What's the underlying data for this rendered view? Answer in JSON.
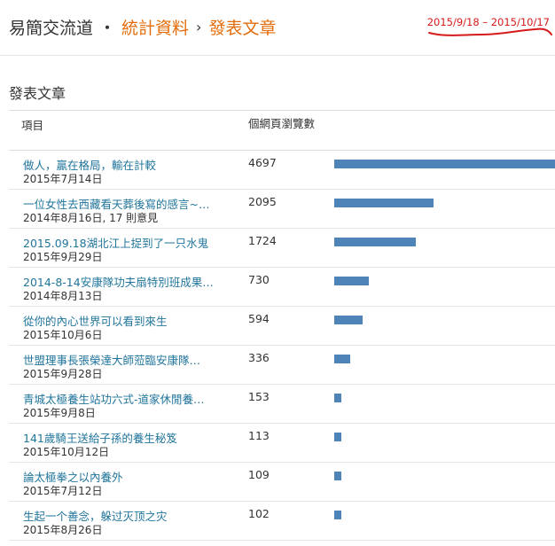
{
  "header": {
    "site_name": "易簡交流道",
    "sep_dot": "・",
    "crumb_stats": "統計資料",
    "sep_arrow": "›",
    "crumb_current": "發表文章",
    "date_range": "2015/9/18 – 2015/10/17"
  },
  "section": {
    "title": "發表文章"
  },
  "table": {
    "col_item": "項目",
    "col_views": "個網頁瀏覽數",
    "max_views": 4697,
    "rows": [
      {
        "title": "做人，贏在格局，輸在計較",
        "meta": "2015年7月14日",
        "views": 4697
      },
      {
        "title": "一位女性去西藏看天葬後寫的感言~…",
        "meta": "2014年8月16日, 17 則意見",
        "views": 2095
      },
      {
        "title": "2015.09.18湖北江上捉到了一只水鬼",
        "meta": "2015年9月29日",
        "views": 1724
      },
      {
        "title": "2014-8-14安康隊功夫扇特別班成果…",
        "meta": "2014年8月13日",
        "views": 730
      },
      {
        "title": "從你的內心世界可以看到來生",
        "meta": "2015年10月6日",
        "views": 594
      },
      {
        "title": "世盟理事長張榮達大師蒞臨安康隊…",
        "meta": "2015年9月28日",
        "views": 336
      },
      {
        "title": "青城太極養生站功六式-道家休閒養…",
        "meta": "2015年9月8日",
        "views": 153
      },
      {
        "title": "141歲騎王送給子孫的養生秘笈",
        "meta": "2015年10月12日",
        "views": 113
      },
      {
        "title": "論太極拳之以內養外",
        "meta": "2015年7月12日",
        "views": 109
      },
      {
        "title": "生起一个善念，躲过灭顶之灾",
        "meta": "2015年8月26日",
        "views": 102
      }
    ]
  },
  "colors": {
    "accent": "#e46c0a",
    "link": "#21759b",
    "bar": "#4e84b8",
    "annotation": "#d61a1a"
  }
}
